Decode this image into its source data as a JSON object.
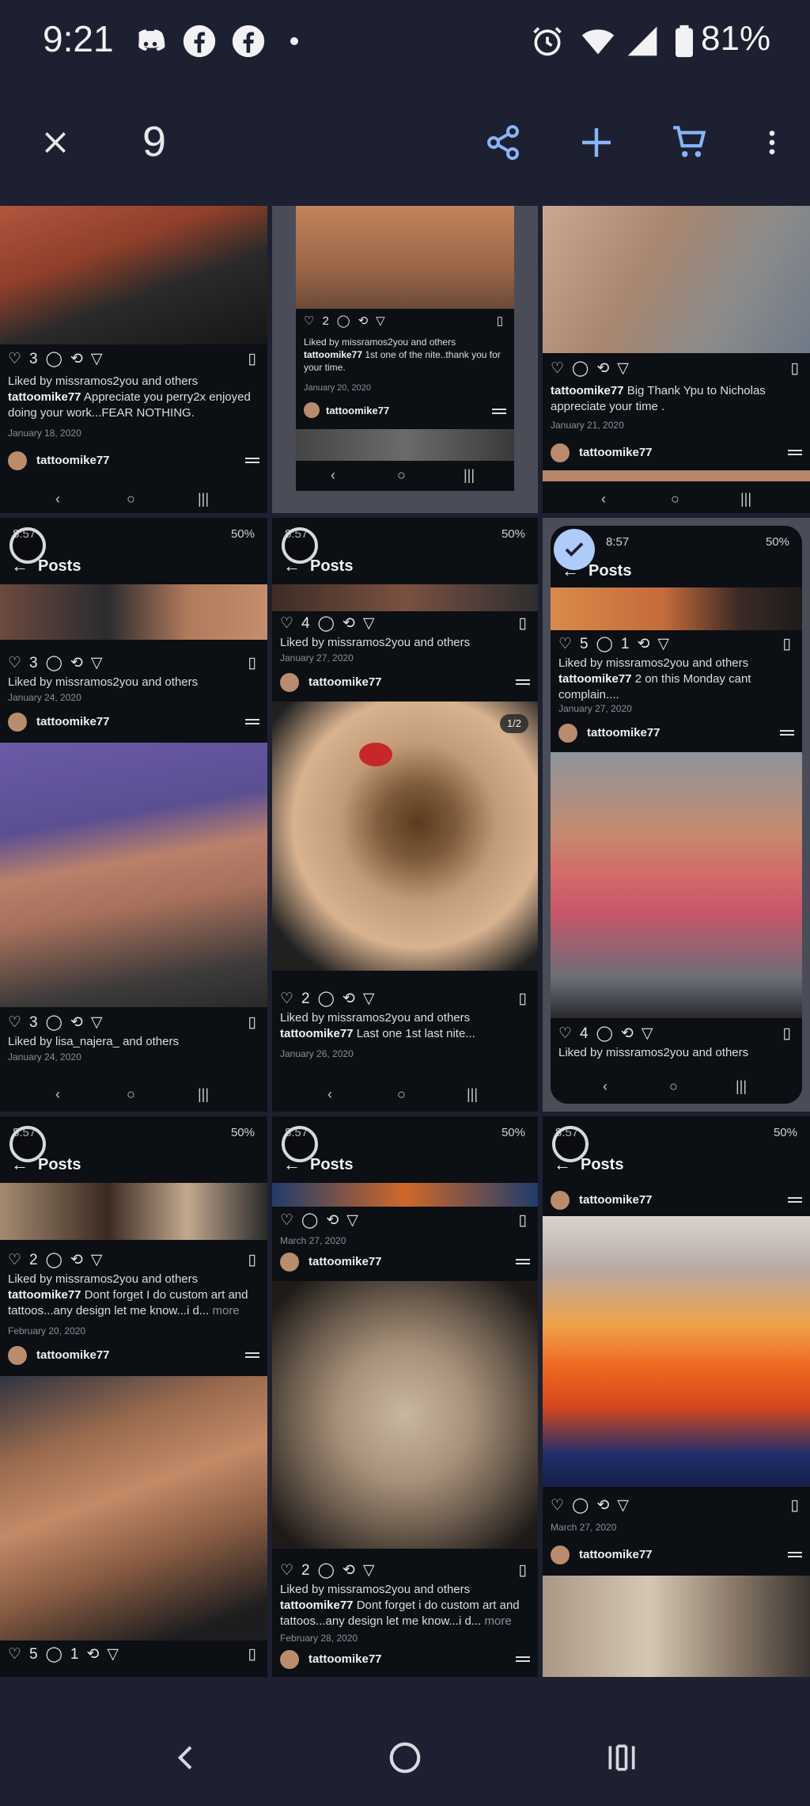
{
  "status_bar": {
    "time": "9:21",
    "battery": "81%",
    "icons": [
      "discord-icon",
      "facebook-icon",
      "facebook-icon",
      "dot-icon",
      "alarm-icon",
      "wifi-icon",
      "signal-icon",
      "battery-icon"
    ]
  },
  "action_bar": {
    "close_icon": "close-icon",
    "selected_count": "9",
    "share_icon": "share-icon",
    "add_icon": "add-icon",
    "cart_icon": "cart-icon",
    "more_icon": "more-vert-icon"
  },
  "tiles": [
    {
      "likes": "3",
      "liked_by": "Liked by missramos2you and others",
      "caption_user": "tattoomike77",
      "caption_text": " Appreciate you perry2x enjoyed doing your work...FEAR NOTHING.",
      "date": "January 18, 2020",
      "footer_user": "tattoomike77"
    },
    {
      "likes": "2",
      "liked_by": "Liked by missramos2you and others",
      "caption_user": "tattoomike77",
      "caption_text": " 1st one of the nite..thank you for your time.",
      "date": "January 20, 2020",
      "footer_user": "tattoomike77"
    },
    {
      "caption_user": "tattoomike77",
      "caption_text": " Big Thank Ypu to Nicholas appreciate your time .",
      "date": "January 21, 2020",
      "footer_user": "tattoomike77"
    },
    {
      "mini_time": "8:57",
      "mini_battery": "50%",
      "header": "Posts",
      "likes": "3",
      "liked_by": "Liked by missramos2you and others",
      "date": "January 24, 2020",
      "footer_user": "tattoomike77",
      "likes2": "3",
      "liked_by2": "Liked by lisa_najera_ and others",
      "date2": "January 24, 2020"
    },
    {
      "mini_time": "8:57",
      "mini_battery": "50%",
      "header": "Posts",
      "likes": "4",
      "liked_by": "Liked by missramos2you and others",
      "date": "January 27, 2020",
      "footer_user": "tattoomike77",
      "page_indicator": "1/2",
      "likes2": "2",
      "liked_by2": "Liked by missramos2you and others",
      "caption_user2": "tattoomike77",
      "caption_text2": " Last one 1st last nite...",
      "date2": "January 26, 2020"
    },
    {
      "mini_time": "8:57",
      "mini_battery": "50%",
      "header": "Posts",
      "likes": "5",
      "comments": "1",
      "liked_by": "Liked by missramos2you and others",
      "caption_user": "tattoomike77",
      "caption_text": " 2 on this Monday cant complain....",
      "date": "January 27, 2020",
      "footer_user": "tattoomike77",
      "likes2": "4",
      "liked_by2": "Liked by missramos2you and others"
    },
    {
      "mini_time": "8:57",
      "mini_battery": "50%",
      "header": "Posts",
      "likes": "2",
      "liked_by": "Liked by missramos2you and others",
      "caption_user": "tattoomike77",
      "caption_text": " Dont forget I do custom art and tattoos...any design let me know...i d...",
      "more": "more",
      "date": "February 20, 2020",
      "footer_user": "tattoomike77",
      "likes2": "5",
      "comments2": "1"
    },
    {
      "mini_time": "8:57",
      "mini_battery": "50%",
      "header": "Posts",
      "date": "March 27, 2020",
      "footer_user": "tattoomike77",
      "likes2": "2",
      "liked_by2": "Liked by missramos2you and others",
      "caption_user2": "tattoomike77",
      "caption_text2": " Dont forget i do custom art and tattoos...any design let me know...i d...",
      "more2": "more",
      "date2": "February 28, 2020",
      "footer_user2": "tattoomike77"
    },
    {
      "mini_time": "8:57",
      "mini_battery": "50%",
      "header": "Posts",
      "top_user": "tattoomike77",
      "date": "March 27, 2020",
      "footer_user": "tattoomike77"
    }
  ],
  "nav_icons": [
    "back-icon",
    "home-icon",
    "recents-icon"
  ],
  "colors": {
    "background": "#1d2030",
    "accent": "#8ab4f8",
    "selected_check": "#aecbfa"
  }
}
